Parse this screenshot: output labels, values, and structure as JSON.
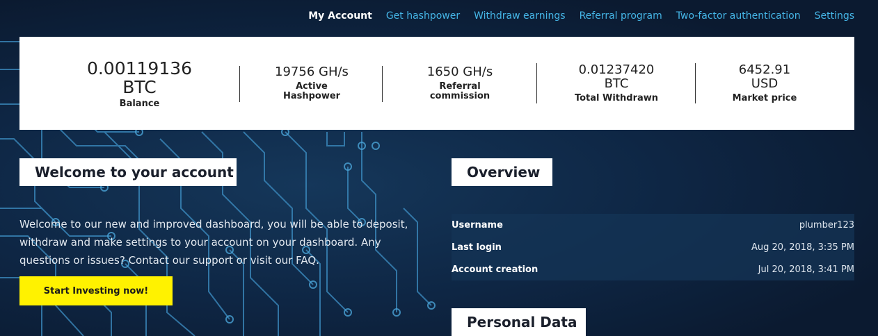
{
  "nav": {
    "items": [
      {
        "label": "My Account",
        "active": true
      },
      {
        "label": "Get hashpower",
        "active": false
      },
      {
        "label": "Withdraw earnings",
        "active": false
      },
      {
        "label": "Referral program",
        "active": false
      },
      {
        "label": "Two-factor authentication",
        "active": false
      },
      {
        "label": "Settings",
        "active": false
      }
    ]
  },
  "stats": {
    "balance": {
      "value": "0.00119136",
      "unit": "BTC",
      "label": "Balance"
    },
    "active_hashpower": {
      "value": "19756 GH/s",
      "label_line1": "Active",
      "label_line2": "Hashpower"
    },
    "referral_commission": {
      "value": "1650 GH/s",
      "label_line1": "Referral",
      "label_line2": "commission"
    },
    "total_withdrawn": {
      "value": "0.01237420",
      "unit": "BTC",
      "label": "Total Withdrawn"
    },
    "market_price": {
      "value": "6452.91",
      "unit": "USD",
      "label": "Market price"
    }
  },
  "welcome": {
    "heading": "Welcome to your account",
    "text": "Welcome to our new and improved dashboard, you will be able to deposit, withdraw and make settings to your account on your dashboard. Any questions or issues? Contact our support or visit our FAQ.",
    "cta_label": "Start Investing now!"
  },
  "overview": {
    "heading": "Overview",
    "rows": [
      {
        "key": "Username",
        "value": "plumber123"
      },
      {
        "key": "Last login",
        "value": "Aug 20, 2018, 3:35 PM"
      },
      {
        "key": "Account creation",
        "value": "Jul 20, 2018, 3:41 PM"
      }
    ]
  },
  "personal": {
    "heading": "Personal Data"
  },
  "colors": {
    "accent_link": "#45b5e6",
    "cta": "#fff200",
    "background": "#0c1a2e"
  }
}
